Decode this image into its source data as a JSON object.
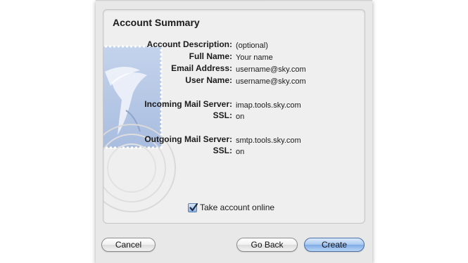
{
  "panel": {
    "title": "Account Summary"
  },
  "fields": [
    {
      "label": "Account Description:",
      "value": "(optional)"
    },
    {
      "label": "Full Name:",
      "value": "Your name"
    },
    {
      "label": "Email Address:",
      "value": "username@sky.com"
    },
    {
      "label": "User Name:",
      "value": "username@sky.com"
    },
    {
      "label": "Incoming Mail Server:",
      "value": "imap.tools.sky.com"
    },
    {
      "label": "SSL:",
      "value": "on"
    },
    {
      "label": "Outgoing Mail Server:",
      "value": "smtp.tools.sky.com"
    },
    {
      "label": "SSL:",
      "value": "on"
    }
  ],
  "take_online": {
    "label": "Take account online",
    "checked": true
  },
  "buttons": {
    "cancel": "Cancel",
    "go_back": "Go Back",
    "create": "Create"
  },
  "colors": {
    "sheet": "#e8e8e8",
    "panel": "#efefef",
    "accent": "#7eaae4"
  }
}
